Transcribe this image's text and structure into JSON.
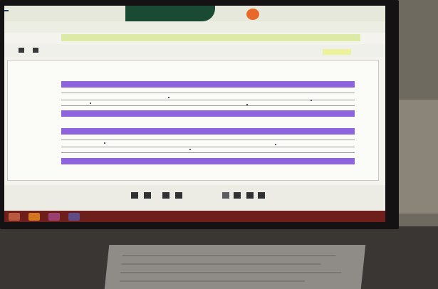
{
  "screen": {
    "logo": {
      "prefix": "",
      "badge": "",
      "suffix": ""
    },
    "app_name": "",
    "breadcrumb": "",
    "green_band_text": "",
    "period_labels": [
      "",
      "",
      ""
    ],
    "chart_title": "",
    "y_axis_labels": [
      "",
      ""
    ]
  },
  "monitor": {
    "brand": ""
  },
  "colors": {
    "band": "#8e63de",
    "header_dark": "#1b4a34",
    "logo_badge": "#e8682a",
    "highlight": "#ddeaa6",
    "taskbar": "#6e1f1c"
  },
  "icons": [
    "back-icon",
    "forward-icon",
    "first-page-icon",
    "prev-page-icon",
    "next-page-icon",
    "last-page-icon"
  ]
}
